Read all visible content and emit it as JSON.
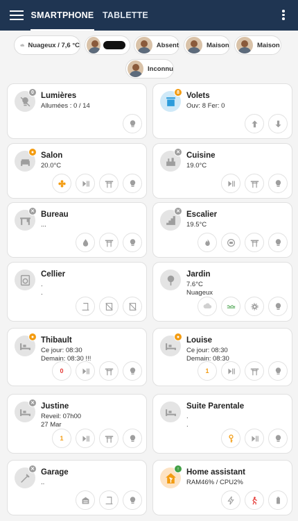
{
  "header": {
    "tabs": [
      "SMARTPHONE",
      "TABLETTE"
    ],
    "menu_icon": "hamburger-menu-icon",
    "overflow_icon": "more-vertical-icon"
  },
  "presence": [
    {
      "label": "Nuageux / 7,6 °C",
      "icon": "cloud-icon"
    },
    {
      "label": ""
    },
    {
      "label": "Absent"
    },
    {
      "label": "Maison"
    },
    {
      "label": "Maison"
    },
    {
      "label": "Inconnu"
    }
  ],
  "cards": {
    "lumieres": {
      "title": "Lumières",
      "l1": "Allumées : 0 / 14",
      "badge": "0"
    },
    "volets": {
      "title": "Volets",
      "l1": "Ouv: 8 Fer: 0",
      "badge": "8"
    },
    "salon": {
      "title": "Salon",
      "l1": "20.0°C"
    },
    "cuisine": {
      "title": "Cuisine",
      "l1": "19.0°C"
    },
    "bureau": {
      "title": "Bureau",
      "l1": "..."
    },
    "escalier": {
      "title": "Escalier",
      "l1": "19.5°C"
    },
    "cellier": {
      "title": "Cellier",
      "l1": ".",
      "l2": "."
    },
    "jardin": {
      "title": "Jardin",
      "l1": "7.6°C",
      "l2": "Nuageux"
    },
    "thibault": {
      "title": "Thibault",
      "l1": "Ce jour: 08:30",
      "l2": "Demain: 08:30 !!!",
      "counter": "0"
    },
    "louise": {
      "title": "Louise",
      "l1": "Ce jour: 08:30",
      "l2": "Demain: 08:30",
      "counter": "1"
    },
    "justine": {
      "title": "Justine",
      "l1": "Reveil:  07h00",
      "l2": "27 Mar",
      "counter": "1"
    },
    "suite": {
      "title": "Suite Parentale",
      "l1": ".",
      "l2": "."
    },
    "garage": {
      "title": "Garage",
      "l1": ".."
    },
    "ha": {
      "title": "Home assistant",
      "l1": "RAM46% / CPU2%"
    }
  },
  "colors": {
    "header": "#1f3552",
    "accent_orange": "#f39c12",
    "alert_red": "#e53935",
    "ok_green": "#43a047"
  }
}
